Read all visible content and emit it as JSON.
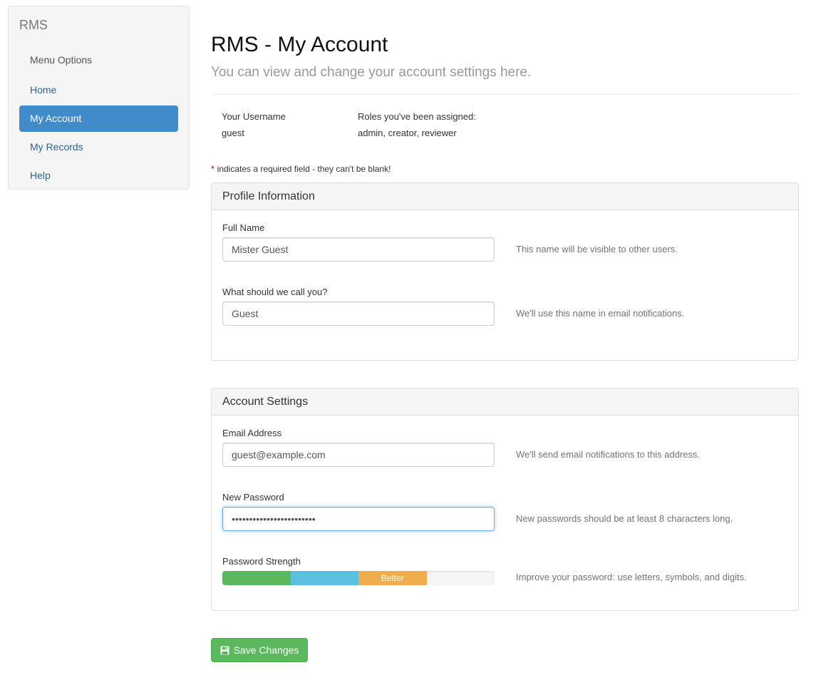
{
  "sidebar": {
    "brand": "RMS",
    "header": "Menu Options",
    "items": [
      {
        "label": "Home",
        "active": false
      },
      {
        "label": "My Account",
        "active": true
      },
      {
        "label": "My Records",
        "active": false
      },
      {
        "label": "Help",
        "active": false
      }
    ]
  },
  "header": {
    "title": "RMS - My Account",
    "subtitle": "You can view and change your account settings here."
  },
  "user_info": {
    "username_label": "Your Username",
    "username": "guest",
    "roles_label": "Roles you've been assigned:",
    "roles": "admin, creator, reviewer"
  },
  "required_note": {
    "star": "*",
    "text": "indicates a required field - they can't be blank!"
  },
  "profile_panel": {
    "title": "Profile Information",
    "full_name_label": "Full Name",
    "full_name_value": "Mister Guest",
    "full_name_help": "This name will be visible to other users.",
    "nickname_label": "What should we call you?",
    "nickname_value": "Guest",
    "nickname_help": "We'll use this name in email notifications."
  },
  "account_panel": {
    "title": "Account Settings",
    "email_label": "Email Address",
    "email_value": "guest@example.com",
    "email_help": "We'll send email notifications to this address.",
    "password_label": "New Password",
    "password_value": "abcdefghijklmnopqrstuvwx",
    "password_help": "New passwords should be at least 8 characters long.",
    "strength_label": "Password Strength",
    "strength_text": "Better",
    "strength_segments_filled": 3,
    "strength_segments_total": 4,
    "strength_help": "Improve your password: use letters, symbols, and digits."
  },
  "save_button": {
    "label": "Save Changes",
    "icon": "floppy-disk-icon"
  },
  "colors": {
    "primary": "#428bca",
    "success": "#5cb85c",
    "info": "#5bc0de",
    "warning": "#f0ad4e"
  }
}
